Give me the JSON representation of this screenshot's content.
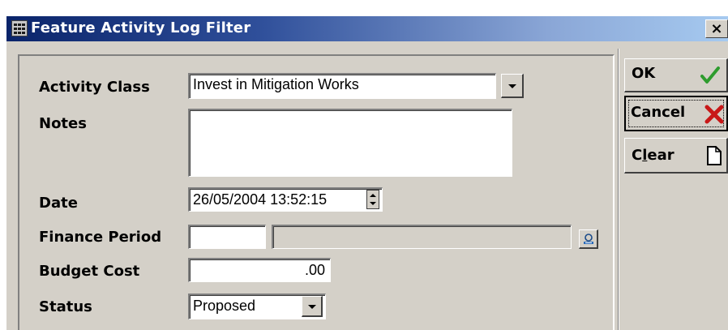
{
  "window": {
    "title": "Feature Activity Log Filter",
    "close_glyph": "×"
  },
  "form": {
    "activity_class": {
      "label": "Activity Class",
      "value": "Invest in Mitigation Works"
    },
    "notes": {
      "label": "Notes",
      "value": ""
    },
    "date": {
      "label": "Date",
      "value": "26/05/2004 13:52:15"
    },
    "finance_period": {
      "label": "Finance Period",
      "code": "",
      "description": ""
    },
    "budget_cost": {
      "label": "Budget Cost",
      "value": ".00"
    },
    "status": {
      "label": "Status",
      "value": "Proposed"
    }
  },
  "buttons": {
    "ok": {
      "label": "OK",
      "icon": "checkmark-icon",
      "color": "#2e9c2e"
    },
    "cancel": {
      "label": "Cancel",
      "icon": "red-x-icon",
      "color": "#c81818"
    },
    "clear": {
      "label_pre": "C",
      "label_mnemonic": "l",
      "label_post": "ear",
      "icon": "blank-page-icon"
    }
  },
  "icons": {
    "lookup": "lookup-icon",
    "app": "grid-app-icon"
  }
}
